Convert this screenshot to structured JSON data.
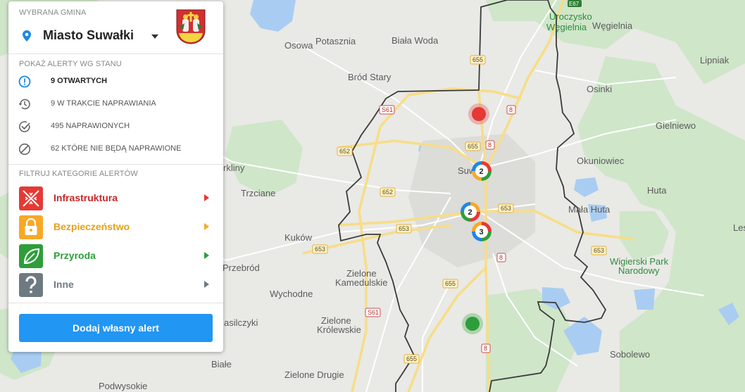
{
  "map": {
    "places": {
      "osowa": "Osowa",
      "potasznia": "Potasznia",
      "biala_woda": "Biała Woda",
      "brod_stary": "Bród Stary",
      "suwalki": "Suwałki",
      "uroczysko": "Uroczysko",
      "wegielnia_green": "Węgielnia",
      "wegielnia": "Węgielnia",
      "lipniak": "Lipniak",
      "osinki": "Osinki",
      "gielniewo": "Gielniewo",
      "okuniowiec": "Okuniowiec",
      "huta": "Huta",
      "mala_huta": "Mała Huta",
      "wigierski_1": "Wigierski Park",
      "wigierski_2": "Narodowy",
      "trzciane": "Trzciane",
      "krkliny": "rkliny",
      "kukow": "Kuków",
      "przebrod": "Przebród",
      "zielone_kam_1": "Zielone",
      "zielone_kam_2": "Kamedulskie",
      "wychodne": "Wychodne",
      "zielone_krol_1": "Zielone",
      "zielone_krol_2": "Królewskie",
      "zielone_drugie": "Zielone Drugie",
      "sobolewo": "Sobolewo",
      "biale": "Białe",
      "podwysokie": "Podwysokie",
      "asilczyki": "asilczyki",
      "les": "Les"
    },
    "roads": {
      "r655_top": "655",
      "s61_top": "S61",
      "r8_top": "8",
      "r652_a": "652",
      "r655_mid": "655",
      "r8_mid": "8",
      "r652_b": "652",
      "r653_a": "653",
      "r653_b": "653",
      "r653_c": "653",
      "r653_d": "653",
      "r8_low": "8",
      "r655_low": "655",
      "s61_low": "S61",
      "r8_bottom": "8",
      "r655_bottom": "655",
      "e67": "E67"
    },
    "clusters": [
      {
        "count": "2"
      },
      {
        "count": "2"
      },
      {
        "count": "3"
      }
    ]
  },
  "panel": {
    "gmina_header": "WYBRANA GMINA",
    "gmina_name": "Miasto Suwałki",
    "status_header": "POKAŻ ALERTY WG STANU",
    "statuses": [
      {
        "label": "9 OTWARTYCH",
        "icon": "exclamation-icon"
      },
      {
        "label": "9 W TRAKCIE NAPRAWIANIA",
        "icon": "history-icon"
      },
      {
        "label": "495 NAPRAWIONYCH",
        "icon": "check-circle-icon"
      },
      {
        "label": "62 KTÓRE NIE BĘDĄ NAPRAWIONE",
        "icon": "block-icon"
      }
    ],
    "category_header": "FILTRUJ KATEGORIE ALERTÓW",
    "categories": [
      {
        "label": "Infrastruktura",
        "color": "#e53935",
        "icon": "infrastructure-icon"
      },
      {
        "label": "Bezpieczeństwo",
        "color": "#f9a825",
        "icon": "lock-icon"
      },
      {
        "label": "Przyroda",
        "color": "#2e9e3a",
        "icon": "leaf-icon"
      },
      {
        "label": "Inne",
        "color": "#6e7a81",
        "icon": "question-icon"
      }
    ],
    "add_button": "Dodaj własny alert"
  }
}
